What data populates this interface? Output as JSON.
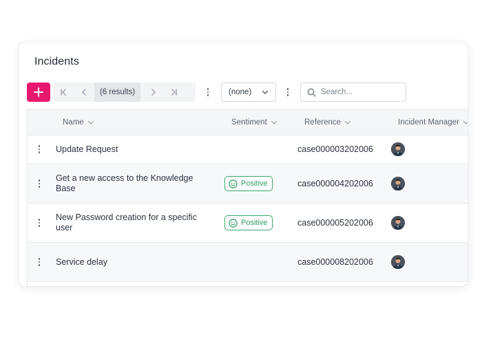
{
  "panel": {
    "title": "Incidents"
  },
  "toolbar": {
    "add_icon": "plus-icon",
    "pager": {
      "results_label": "(6 results)"
    },
    "view_select": {
      "value": "(none)"
    },
    "search": {
      "placeholder": "Search..."
    }
  },
  "colors": {
    "accent": "#e8186f",
    "positive": "#2f9c62"
  },
  "table": {
    "columns": [
      {
        "label": "Name"
      },
      {
        "label": "Sentiment"
      },
      {
        "label": "Reference"
      },
      {
        "label": "Incident Manager"
      }
    ],
    "rows": [
      {
        "name": "Update Request",
        "sentiment": "",
        "reference": "case000003202006",
        "manager_icon": "avatar"
      },
      {
        "name": "Get a new access to the Knowledge Base",
        "sentiment": "Positive",
        "reference": "case000004202006",
        "manager_icon": "avatar"
      },
      {
        "name": "New Password creation for a specific user",
        "sentiment": "Positive",
        "reference": "case000005202006",
        "manager_icon": "avatar"
      },
      {
        "name": "Service delay",
        "sentiment": "",
        "reference": "case000008202006",
        "manager_icon": "avatar"
      }
    ]
  }
}
